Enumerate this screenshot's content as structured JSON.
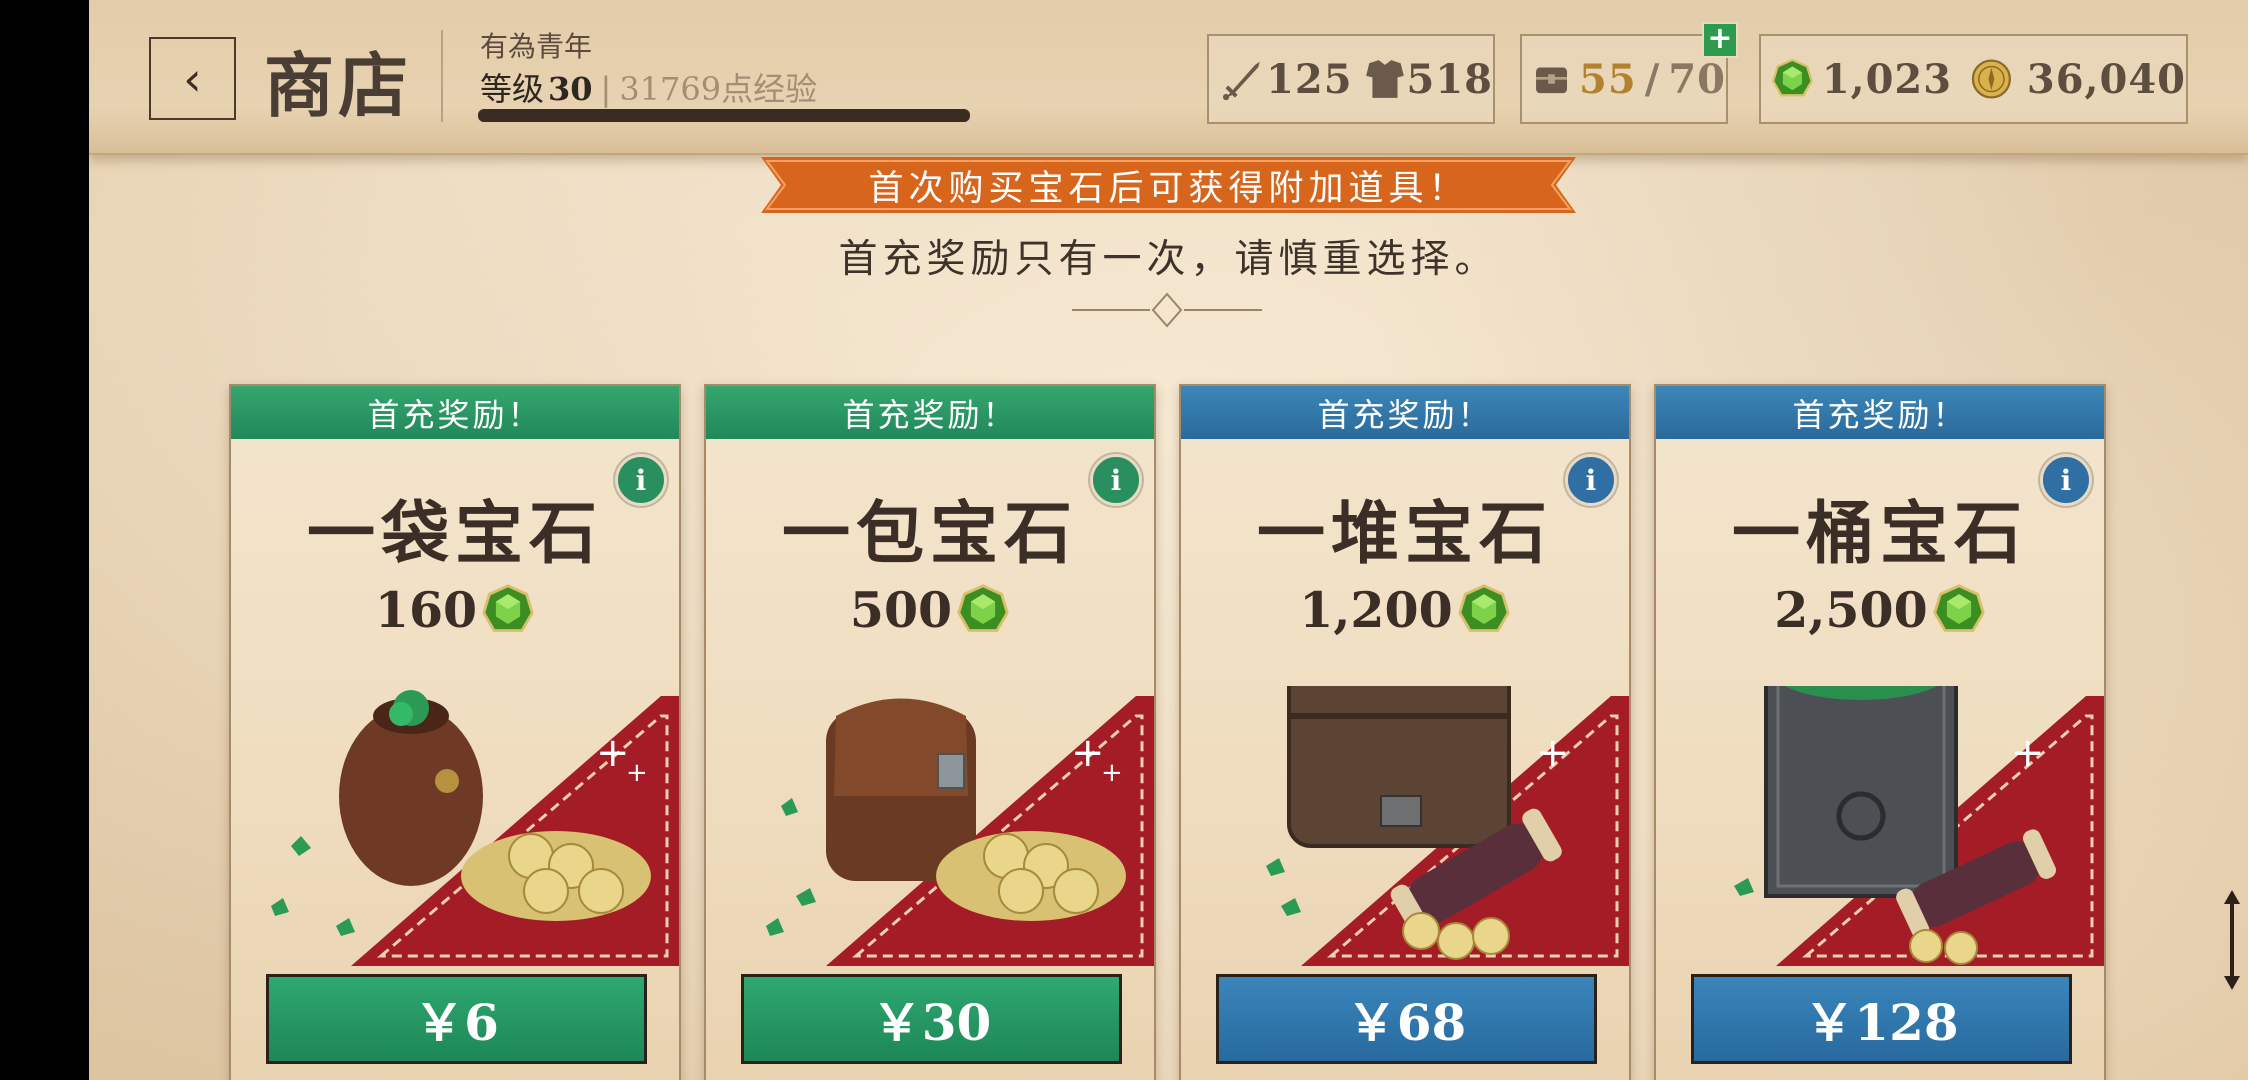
{
  "header": {
    "back_icon": "chevron-left-icon",
    "title": "商店",
    "player_title": "有為青年",
    "level_label": "等级",
    "level": "30",
    "separator": "|",
    "xp_text": "31769点经验",
    "xp_progress": 1.0
  },
  "stats": {
    "attack": "125",
    "armor": "518",
    "inventory_current": "55",
    "inventory_separator": "/",
    "inventory_max": "70",
    "add_badge": "+",
    "gems": "1,023",
    "gold": "36,040"
  },
  "banner": {
    "headline": "首次购买宝石后可获得附加道具！",
    "note": "首充奖励只有一次，请慎重选择。"
  },
  "colors": {
    "green": "#23895b",
    "blue": "#2d6c9d",
    "banner_orange": "#dd6a1f",
    "gold": "#b3822e"
  },
  "cards": [
    {
      "ribbon": "首充奖励！",
      "name": "一袋宝石",
      "amount": "160",
      "price": "￥6",
      "theme": "green",
      "art": "gem-pouch"
    },
    {
      "ribbon": "首充奖励！",
      "name": "一包宝石",
      "amount": "500",
      "price": "￥30",
      "theme": "green",
      "art": "gem-satchel"
    },
    {
      "ribbon": "首充奖励！",
      "name": "一堆宝石",
      "amount": "1,200",
      "price": "￥68",
      "theme": "blue",
      "art": "gem-chest"
    },
    {
      "ribbon": "首充奖励！",
      "name": "一桶宝石",
      "amount": "2,500",
      "price": "￥128",
      "theme": "blue",
      "art": "gem-crate"
    }
  ]
}
